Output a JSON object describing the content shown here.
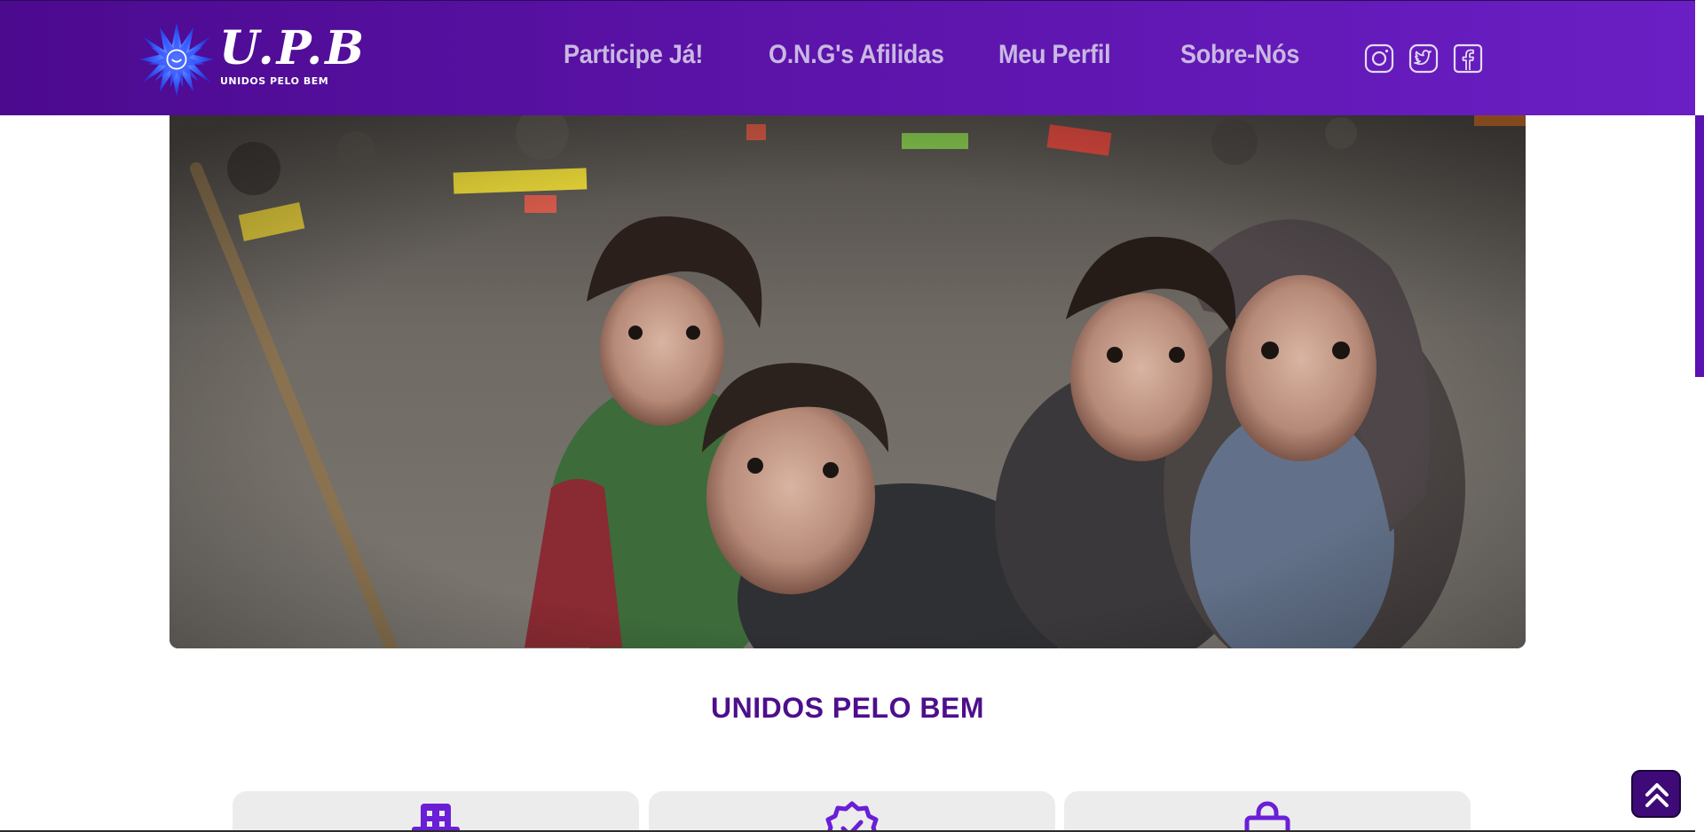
{
  "brand": {
    "title": "U.P.B",
    "subtitle": "UNIDOS PELO BEM",
    "star_icon": "star-burst-logo",
    "accent_color": "#5b13a8",
    "logo_blue": "#2f5bff"
  },
  "nav": {
    "items": [
      {
        "label": "Participe Já!"
      },
      {
        "label": "O.N.G's Afilidas"
      },
      {
        "label": "Meu Perfil"
      },
      {
        "label": "Sobre-Nós"
      }
    ],
    "social": [
      {
        "icon": "instagram-icon"
      },
      {
        "icon": "twitter-icon"
      },
      {
        "icon": "facebook-icon"
      }
    ]
  },
  "hero": {
    "image": "photo-four-children"
  },
  "section": {
    "title": "UNIDOS PELO BEM"
  },
  "cards": [
    {
      "icon": "building-icon"
    },
    {
      "icon": "verified-badge-icon"
    },
    {
      "icon": "shopping-bag-icon"
    }
  ],
  "back_to_top": {
    "icon": "double-chevron-up-icon"
  }
}
